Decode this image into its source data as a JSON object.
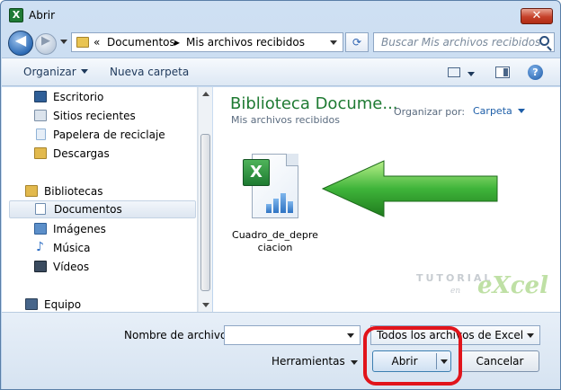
{
  "window": {
    "title": "Abrir",
    "close_glyph": "✕",
    "app_icon_glyph": "X"
  },
  "address_bar": {
    "prefix": "«",
    "crumbs": [
      "Documentos",
      "Mis archivos recibidos"
    ],
    "separator": "▸"
  },
  "search": {
    "placeholder": "Buscar Mis archivos recibidos"
  },
  "toolbar": {
    "organize": "Organizar",
    "new_folder": "Nueva carpeta",
    "help_glyph": "?"
  },
  "nav": {
    "items": [
      {
        "label": "Escritorio",
        "icon": "desktop-icon",
        "color": "#2f5f98"
      },
      {
        "label": "Sitios recientes",
        "icon": "recent-places-icon",
        "color": "#7b8fa6"
      },
      {
        "label": "Papelera de reciclaje",
        "icon": "recycle-bin-icon",
        "color": "#8fb2d6"
      },
      {
        "label": "Descargas",
        "icon": "downloads-icon",
        "color": "#e2b94d"
      },
      {
        "label": "Bibliotecas",
        "icon": "libraries-icon",
        "color": "#e2b94d"
      },
      {
        "label": "Documentos",
        "icon": "documents-icon",
        "color": "#a9bfd8",
        "selected": true
      },
      {
        "label": "Imágenes",
        "icon": "pictures-icon",
        "color": "#5c8fc9"
      },
      {
        "label": "Música",
        "icon": "music-icon",
        "color": "#2f6fc4"
      },
      {
        "label": "Vídeos",
        "icon": "videos-icon",
        "color": "#3a4b5f"
      },
      {
        "label": "Equipo",
        "icon": "computer-icon",
        "color": "#47658a"
      }
    ]
  },
  "content": {
    "library_title": "Biblioteca Docume...",
    "library_subtitle": "Mis archivos recibidos",
    "arrange_label": "Organizar por:",
    "arrange_value": "Carpeta",
    "file": {
      "name_line1": "Cuadro_de_depre",
      "name_line2": "ciacion",
      "badge": "X"
    },
    "watermark": {
      "tutorial": "TUTORIAL",
      "en": "en",
      "excel": "eXcel"
    },
    "arrow_color": "#3fb43a"
  },
  "footer": {
    "filename_label": "Nombre de archivo:",
    "filename_value": "",
    "filetype_value": "Todos los archivos de Excel",
    "tools_label": "Herramientas",
    "open_label": "Abrir",
    "cancel_label": "Cancelar",
    "highlight_color": "#e1141b"
  }
}
